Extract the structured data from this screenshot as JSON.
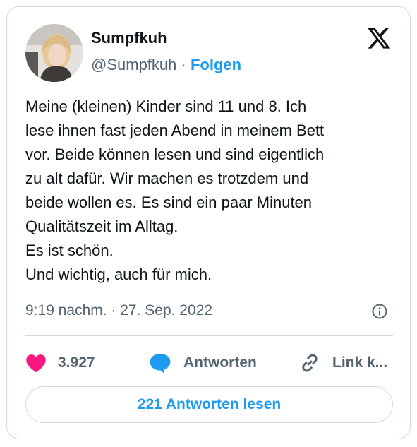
{
  "author": {
    "display_name": "Sumpfkuh",
    "handle": "@Sumpfkuh",
    "separator": "·",
    "follow_label": "Folgen",
    "avatar_icon": "profile-photo"
  },
  "brand": {
    "logo_icon": "x-logo-icon"
  },
  "tweet": {
    "lines": [
      "Meine (kleinen) Kinder sind 11 und 8. Ich",
      "lese ihnen fast jeden Abend in meinem Bett",
      "vor. Beide können lesen und sind eigentlich",
      "zu alt dafür. Wir machen es trotzdem und",
      "beide wollen es. Es sind ein paar Minuten",
      "Qualitätszeit im Alltag.",
      "Es ist schön.",
      "Und wichtig, auch für mich."
    ],
    "timestamp": "9:19 nachm. · 27. Sep. 2022",
    "info_icon": "info-icon"
  },
  "actions": {
    "like_count": "3.927",
    "reply_label": "Antworten",
    "copy_link_label": "Link k...",
    "like_color": "#f91880",
    "reply_color": "#1d9bf0"
  },
  "read_replies_label": "221 Antworten lesen"
}
